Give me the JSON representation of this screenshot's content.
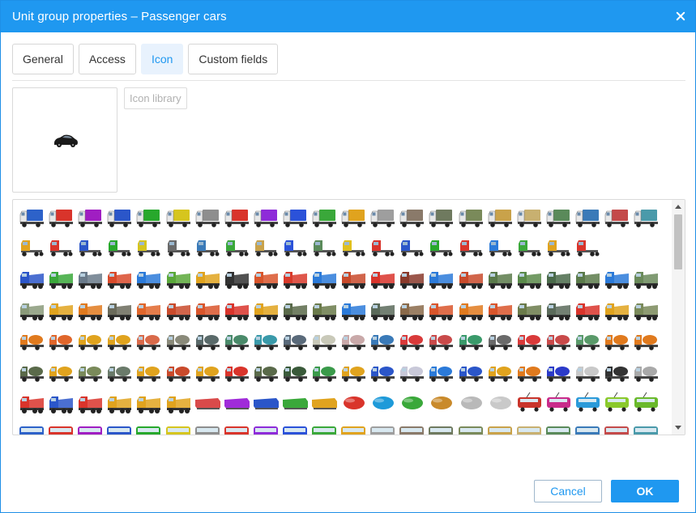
{
  "dialog": {
    "title": "Unit group properties – Passenger cars",
    "close_icon": "close-icon"
  },
  "tabs": [
    {
      "label": "General",
      "active": false
    },
    {
      "label": "Access",
      "active": false
    },
    {
      "label": "Icon",
      "active": true
    },
    {
      "label": "Custom fields",
      "active": false
    }
  ],
  "preview": {
    "icon": "black-passenger-car-icon"
  },
  "library_button": {
    "label": "Icon library"
  },
  "icon_grid": {
    "rows": [
      [
        "#2d62c9",
        "#d9342b",
        "#a01ec2",
        "#2b56c9",
        "#27a82c",
        "#d6c51e",
        "#8e8e8e",
        "#d9342b",
        "#8e2bd9",
        "#2b52d9",
        "#3aa83a",
        "#e0a31e",
        "#9e9e9e",
        "#8a7a6a",
        "#6f7a5f",
        "#7a8a5a",
        "#c9a24a",
        "#c8b070",
        "#5a8a5a",
        "#3a7ab8",
        "#c44a4a",
        "#4a9aaa"
      ],
      [
        "#e0a31e",
        "#d9342b",
        "#2b56c9",
        "#27a82c",
        "#d6c51e",
        "#6a6a6a",
        "#3a7ab8",
        "#3aa83a",
        "#c9a24a",
        "#2b52d9",
        "#5a8a5a",
        "#e0c01e",
        "#d9342b",
        "#2b56c9",
        "#27a82c",
        "#d9342b",
        "#2b7ad9",
        "#3aa83a",
        "#e0a31e",
        "#d9342b"
      ],
      [
        "#2b56c9",
        "#3aa83a",
        "#6a7a8a",
        "#d94a2b",
        "#2b7ad9",
        "#5aa83a",
        "#e0a31e",
        "#333333",
        "#d9552b",
        "#d93a2b",
        "#2b7ad9",
        "#c94a2b",
        "#d9342b",
        "#8a3a2b",
        "#2b7ad9",
        "#c94a2b",
        "#5a7a4a",
        "#5a8a4a",
        "#4a6a4a",
        "#5a7a4a",
        "#2b7ad9",
        "#6a8a5a"
      ],
      [
        "#8a9a7a",
        "#e0a31e",
        "#e07a1e",
        "#6a6a5a",
        "#e0662b",
        "#c94a2b",
        "#d9552b",
        "#d9342b",
        "#e0a31e",
        "#5a6a4a",
        "#6a7a4a",
        "#2b7ad9",
        "#5a6a5a",
        "#8a6a4a",
        "#d9552b",
        "#e07a1e",
        "#d9552b",
        "#6a7a4a",
        "#5a6a5a",
        "#d9342b",
        "#e0a31e",
        "#7a8a5a"
      ],
      [
        "#e07a1e",
        "#e0662b",
        "#e0a31e",
        "#e0a31e",
        "#d96a4a",
        "#8a8a7a",
        "#5a6a6a",
        "#4a8a6a",
        "#3a9aaa",
        "#5a6a7a",
        "#c9c9b9",
        "#c9a9a9",
        "#3a7ab8",
        "#d93a3a",
        "#c94a4a",
        "#3a9a6a",
        "#6a6a6a",
        "#d93a3a",
        "#c94a4a",
        "#5a9a6a",
        "#e07a1e",
        "#e07a1e"
      ],
      [
        "#5a6a4a",
        "#e0a31e",
        "#7a8a5a",
        "#6a7a6a",
        "#e0a31e",
        "#c94a2b",
        "#e0a31e",
        "#d9342b",
        "#5a6a4a",
        "#3a5a3a",
        "#3a9a4a",
        "#e0a31e",
        "#2b56c9",
        "#c9c9d9",
        "#2b7ad9",
        "#2b56c9",
        "#e0a31e",
        "#e07a1e",
        "#2b3ac9",
        "#c9c9c9",
        "#333333",
        "#a9a9a9"
      ],
      [
        "#d9342b",
        "#2b56c9",
        "#d9342b",
        "#e0a31e",
        "#e0a31e",
        "#e0a31e",
        "#d94a4a",
        "#a02bd9",
        "#2b56c9",
        "#3aa83a",
        "#e0a31e",
        "#d9342b",
        "#1e9ad9",
        "#3aa83a",
        "#c98a2b",
        "#b9b9b9",
        "#c9c9c9",
        "#c9342b",
        "#c92b8a",
        "#2b9ad9",
        "#8ac92b",
        "#6ab92b"
      ]
    ],
    "row_kinds": [
      "truck",
      "tractor",
      "heavy",
      "heavy",
      "mixed",
      "mixed",
      "special"
    ]
  },
  "footer": {
    "cancel_label": "Cancel",
    "ok_label": "OK"
  }
}
